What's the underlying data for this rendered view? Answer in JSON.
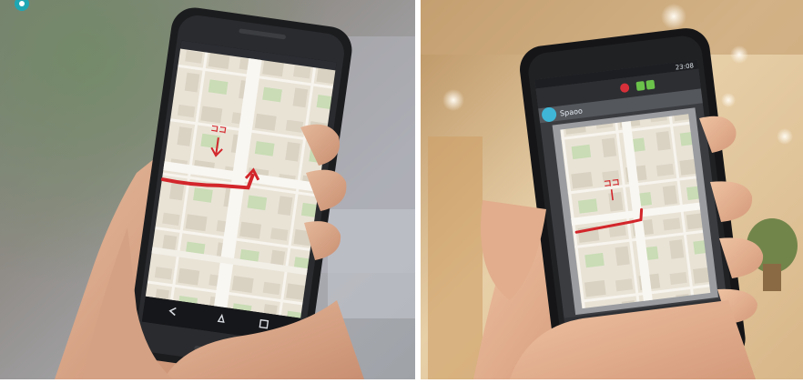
{
  "left_photo": {
    "description_hidden": "",
    "phone": {
      "status_time": "",
      "map_annotation": "ココ"
    }
  },
  "right_photo": {
    "phone": {
      "status_time": "23:08",
      "app_title": "Spaoo",
      "map_annotation": "ココ"
    }
  },
  "colors": {
    "annotation": "#d2262b",
    "top_title_teal": "#1fa6b3"
  }
}
